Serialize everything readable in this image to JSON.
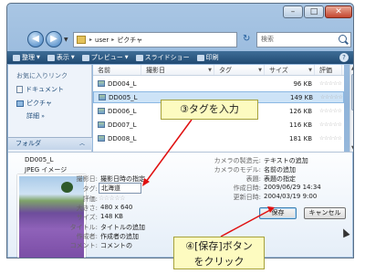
{
  "window": {
    "buttons": {
      "minimize": "–",
      "maximize": "□",
      "close": "✕"
    }
  },
  "address": {
    "segments": [
      "user",
      "ピクチャ"
    ],
    "search_placeholder": "検索"
  },
  "toolbar": {
    "items": [
      "整理",
      "表示",
      "プレビュー",
      "スライドショー",
      "印刷"
    ],
    "help": "?"
  },
  "nav": {
    "heading": "お気に入りリンク",
    "items": [
      "ドキュメント",
      "ピクチャ"
    ],
    "more": "詳細",
    "folder_label": "フォルダ"
  },
  "filelist": {
    "columns": [
      "名前",
      "撮影日",
      "タグ",
      "サイズ",
      "評価"
    ],
    "rows": [
      {
        "name": "DD004_L",
        "size": "96 KB"
      },
      {
        "name": "DD005_L",
        "size": "149 KB"
      },
      {
        "name": "DD006_L",
        "size": "126 KB"
      },
      {
        "name": "DD007_L",
        "size": "116 KB"
      },
      {
        "name": "DD008_L",
        "size": "181 KB"
      }
    ],
    "selected_index": 1,
    "stars": "☆☆☆☆☆"
  },
  "details": {
    "name": "DD005_L",
    "type": "JPEG イメージ",
    "labels": {
      "date_taken": "撮影日:",
      "tag": "タグ:",
      "rating": "評価:",
      "dimensions": "大きさ:",
      "size": "サイズ:",
      "title": "タイトル:",
      "author": "作成者:",
      "comment": "コメント:",
      "camera_maker": "カメラの製造元:",
      "camera_model": "カメラのモデル:",
      "subject": "表題:",
      "created": "作成日時:",
      "modified": "更新日時:"
    },
    "values": {
      "date_taken": "撮影日時の指定",
      "tag": "北海道",
      "rating": "☆☆☆☆☆",
      "dimensions": "480 x 640",
      "size": "148 KB",
      "title": "タイトルの追加",
      "author": "作成者の追加",
      "comment": "コメントの",
      "camera_maker": "テキストの追加",
      "camera_model": "名前の追加",
      "subject": "表題の指定",
      "created": "2009/06/29 14:34",
      "modified": "2004/03/19 9:00"
    },
    "save_label": "保存",
    "cancel_label": "キャンセル"
  },
  "callouts": {
    "tag": "③タグを入力",
    "save_line1": "④[保存]ボタン",
    "save_line2": "をクリック"
  },
  "colors": {
    "callout_bg": "#fdfbc0",
    "arrow": "#e01010",
    "selection": "#cde3f7"
  }
}
